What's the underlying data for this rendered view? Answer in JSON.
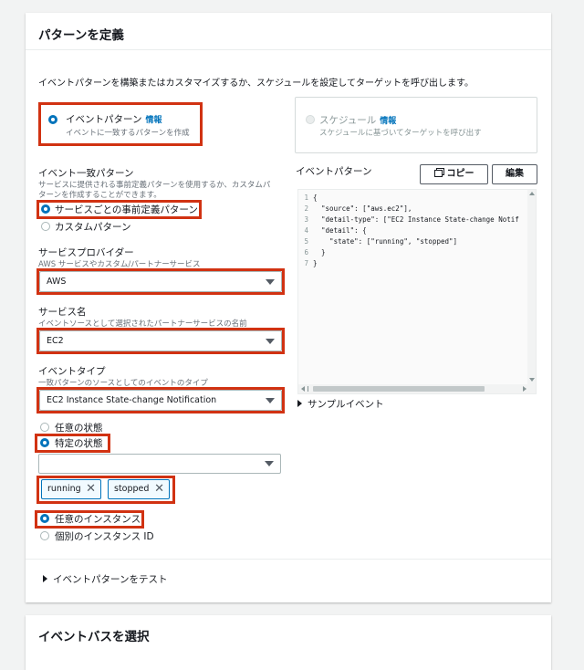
{
  "section1": {
    "title": "パターンを定義",
    "intro": "イベントパターンを構築またはカスタマイズするか、スケジュールを設定してターゲットを呼び出します。",
    "options": [
      {
        "label": "イベントパターン",
        "info": "情報",
        "desc": "イベントに一致するパターンを作成",
        "selected": true
      },
      {
        "label": "スケジュール",
        "info": "情報",
        "desc": "スケジュールに基づいてターゲットを呼び出す",
        "selected": false
      }
    ]
  },
  "match_pattern": {
    "label": "イベント一致パターン",
    "desc_line1": "サービスに提供される事前定義パターンを使用するか、カスタムパ",
    "desc_line2": "ターンを作成することができます。",
    "options": [
      "サービスごとの事前定義パターン",
      "カスタムパターン"
    ],
    "selected_index": 0
  },
  "service_provider": {
    "label": "サービスプロバイダー",
    "desc": "AWS サービスやカスタム/パートナーサービス",
    "value": "AWS"
  },
  "service_name": {
    "label": "サービス名",
    "desc": "イベントソースとして選択されたパートナーサービスの名前",
    "value": "EC2"
  },
  "event_type": {
    "label": "イベントタイプ",
    "desc": "一致パターンのソースとしてのイベントのタイプ",
    "value": "EC2 Instance State-change Notification"
  },
  "state": {
    "options": [
      "任意の状態",
      "特定の状態"
    ],
    "selected_index": 1,
    "select_value": "",
    "tokens": [
      "running",
      "stopped"
    ]
  },
  "instance": {
    "options": [
      "任意のインスタンス",
      "個別のインスタンス ID"
    ],
    "selected_index": 0
  },
  "event_pattern_panel": {
    "label": "イベントパターン",
    "copy_button": "コピー",
    "edit_button": "編集",
    "line_numbers": [
      "1",
      "2",
      "3",
      "4",
      "5",
      "6",
      "7"
    ],
    "code_lines": [
      "{",
      "  \"source\": [\"aws.ec2\"],",
      "  \"detail-type\": [\"EC2 Instance State-change Notif",
      "  \"detail\": {",
      "    \"state\": [\"running\", \"stopped\"]",
      "  }",
      "}"
    ],
    "sample_events": "サンプルイベント"
  },
  "test_pattern": "イベントパターンをテスト",
  "section2": {
    "title": "イベントバスを選択"
  },
  "colors": {
    "accent": "#0073bb",
    "highlight": "#d13212"
  }
}
